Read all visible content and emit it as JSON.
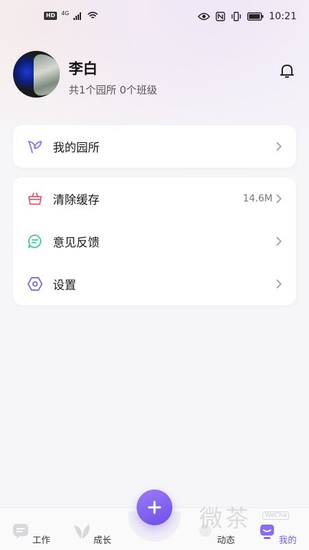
{
  "status_bar": {
    "network_badge": "HD",
    "network_type": "4G",
    "time": "10:21",
    "icons": [
      "signal-icon",
      "wifi-icon",
      "eye-icon",
      "nfc-icon",
      "vibrate-icon",
      "battery-icon"
    ]
  },
  "profile": {
    "name": "李白",
    "summary": "共1个园所 0个班级",
    "notification_icon": "bell-icon"
  },
  "menu": {
    "card1": [
      {
        "label": "我的园所",
        "icon": "sprout-icon",
        "value": ""
      }
    ],
    "card2": [
      {
        "label": "清除缓存",
        "icon": "basket-icon",
        "value": "14.6M"
      },
      {
        "label": "意见反馈",
        "icon": "chat-icon",
        "value": ""
      },
      {
        "label": "设置",
        "icon": "hexagon-settings-icon",
        "value": ""
      }
    ]
  },
  "bottom_nav": {
    "items": [
      {
        "label": "工作",
        "icon": "work-icon"
      },
      {
        "label": "成长",
        "icon": "leaf-icon"
      },
      {
        "label": "动态",
        "icon": "feed-icon"
      },
      {
        "label": "我的",
        "icon": "mine-icon",
        "active": true
      }
    ],
    "fab_icon": "plus-icon"
  },
  "watermark": {
    "text": "微茶",
    "small": "WeCha"
  },
  "colors": {
    "accent": "#7b5cf0",
    "sprout": "#8a74f0",
    "basket": "#e85a6a",
    "chat": "#3cc9a0",
    "settings": "#7b5cf0"
  }
}
